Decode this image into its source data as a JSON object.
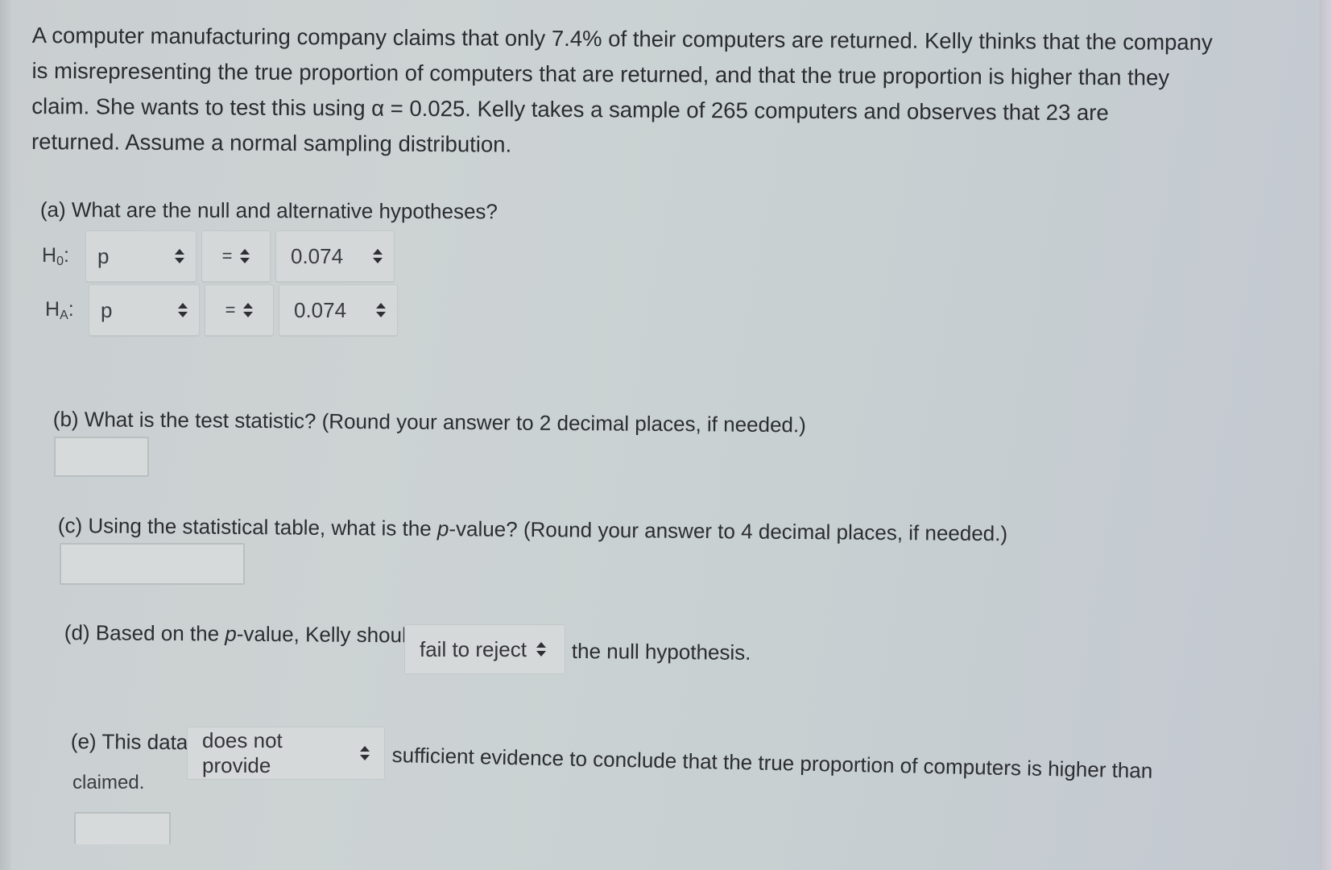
{
  "problem": {
    "lines": [
      "A computer manufacturing company claims that only 7.4% of their computers are returned. Kelly thinks that the company",
      "is misrepresenting the true proportion of computers that are returned, and that the true proportion is higher than they",
      "claim. She wants to test this using α = 0.025. Kelly takes a sample of 265 computers and observes that 23 are",
      "returned. Assume a normal sampling distribution."
    ]
  },
  "part_a": {
    "question": "(a) What are the null and alternative hypotheses?",
    "null": {
      "label_main": "H",
      "label_sub": "0",
      "label_colon": ":",
      "parameter": "p",
      "operator": "=",
      "value": "0.074"
    },
    "alternative": {
      "label_main": "H",
      "label_sub": "A",
      "label_colon": ":",
      "parameter": "p",
      "operator": "=",
      "value": "0.074"
    }
  },
  "part_b": {
    "question": "(b) What is the test statistic? (Round your answer to 2 decimal places, if needed.)",
    "answer": ""
  },
  "part_c": {
    "question_prefix": "(c) Using the statistical table, what is the ",
    "question_italic": "p",
    "question_suffix": "-value? (Round your answer to 4 decimal places, if needed.)",
    "answer": ""
  },
  "part_d": {
    "prefix": "(d) Based on the ",
    "italic": "p",
    "middle": "-value, Kelly should",
    "selected": "fail to reject",
    "suffix": "the null hypothesis."
  },
  "part_e": {
    "prefix": "(e) This data",
    "selected": "does not provide",
    "suffix": "sufficient evidence to conclude that the true proportion of computers is higher than",
    "continuation": "claimed."
  },
  "part_f": {
    "answer": ""
  }
}
